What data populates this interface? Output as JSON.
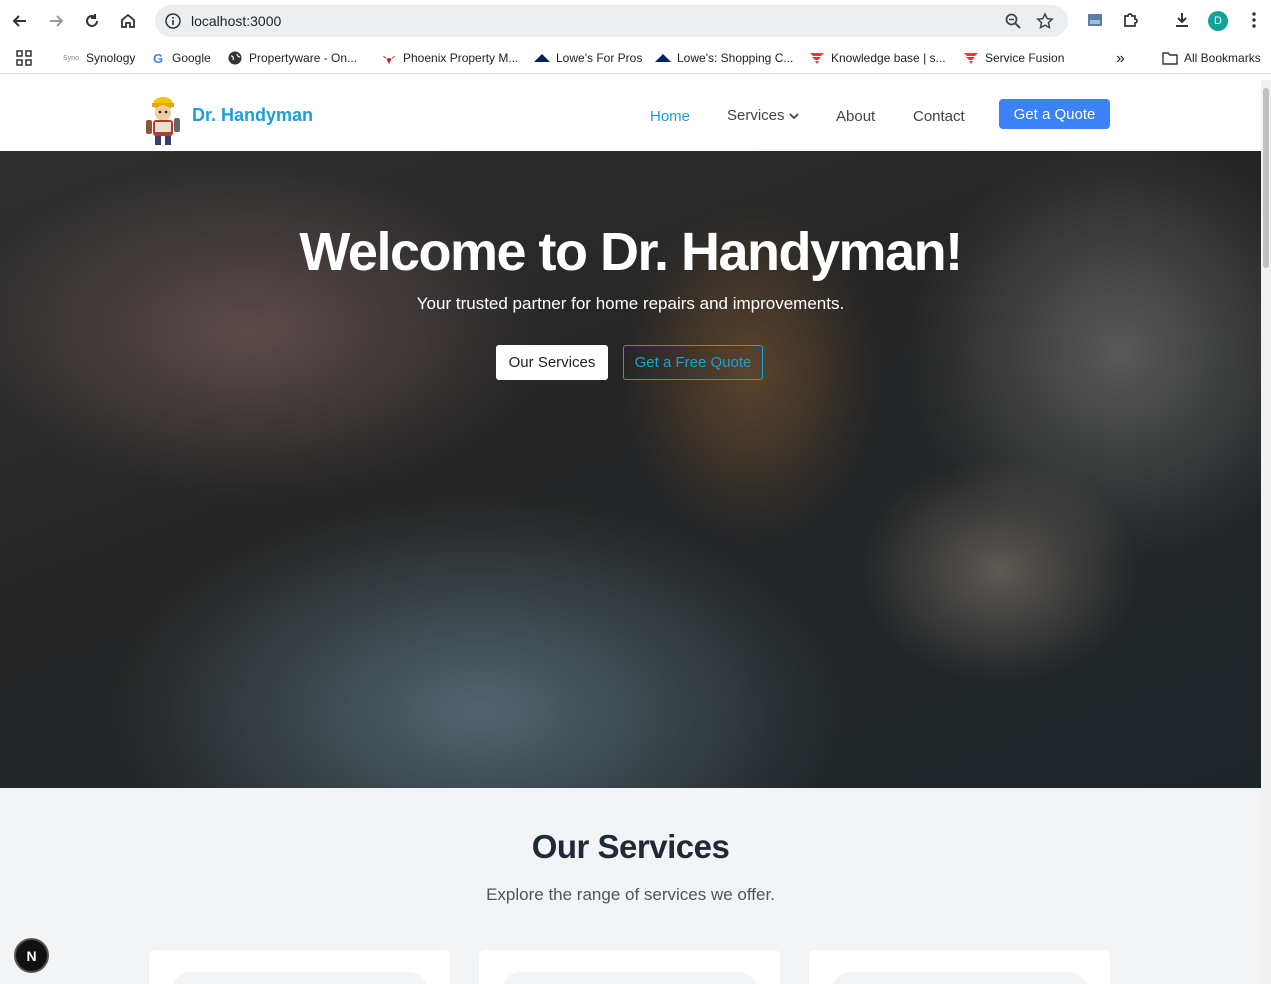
{
  "browser": {
    "url": "localhost:3000",
    "profile_initial": "D",
    "bookmarks": [
      {
        "label": "Synology",
        "icon": "synology-icon"
      },
      {
        "label": "Google",
        "icon": "google-icon"
      },
      {
        "label": "Propertyware - On...",
        "icon": "globe-icon"
      },
      {
        "label": "Phoenix Property M...",
        "icon": "phoenix-icon"
      },
      {
        "label": "Lowe's For Pros",
        "icon": "lowes-icon"
      },
      {
        "label": "Lowe's: Shopping C...",
        "icon": "lowes-icon"
      },
      {
        "label": "Knowledge base | s...",
        "icon": "service-fusion-icon"
      },
      {
        "label": "Service Fusion",
        "icon": "service-fusion-icon"
      }
    ],
    "all_bookmarks": "All Bookmarks",
    "overflow": "»"
  },
  "site": {
    "brand": "Dr. Handyman",
    "nav": {
      "home": "Home",
      "services": "Services",
      "about": "About",
      "contact": "Contact",
      "quote": "Get a Quote"
    },
    "hero": {
      "title": "Welcome to Dr. Handyman!",
      "subtitle": "Your trusted partner for home repairs and improvements.",
      "btn_services": "Our Services",
      "btn_quote": "Get a Free Quote"
    },
    "services": {
      "title": "Our Services",
      "subtitle": "Explore the range of services we offer."
    },
    "dev_badge": "N"
  },
  "colors": {
    "accent": "#1a9fd6",
    "primary_button": "#3b82f6",
    "section_bg": "#f3f4f6"
  }
}
